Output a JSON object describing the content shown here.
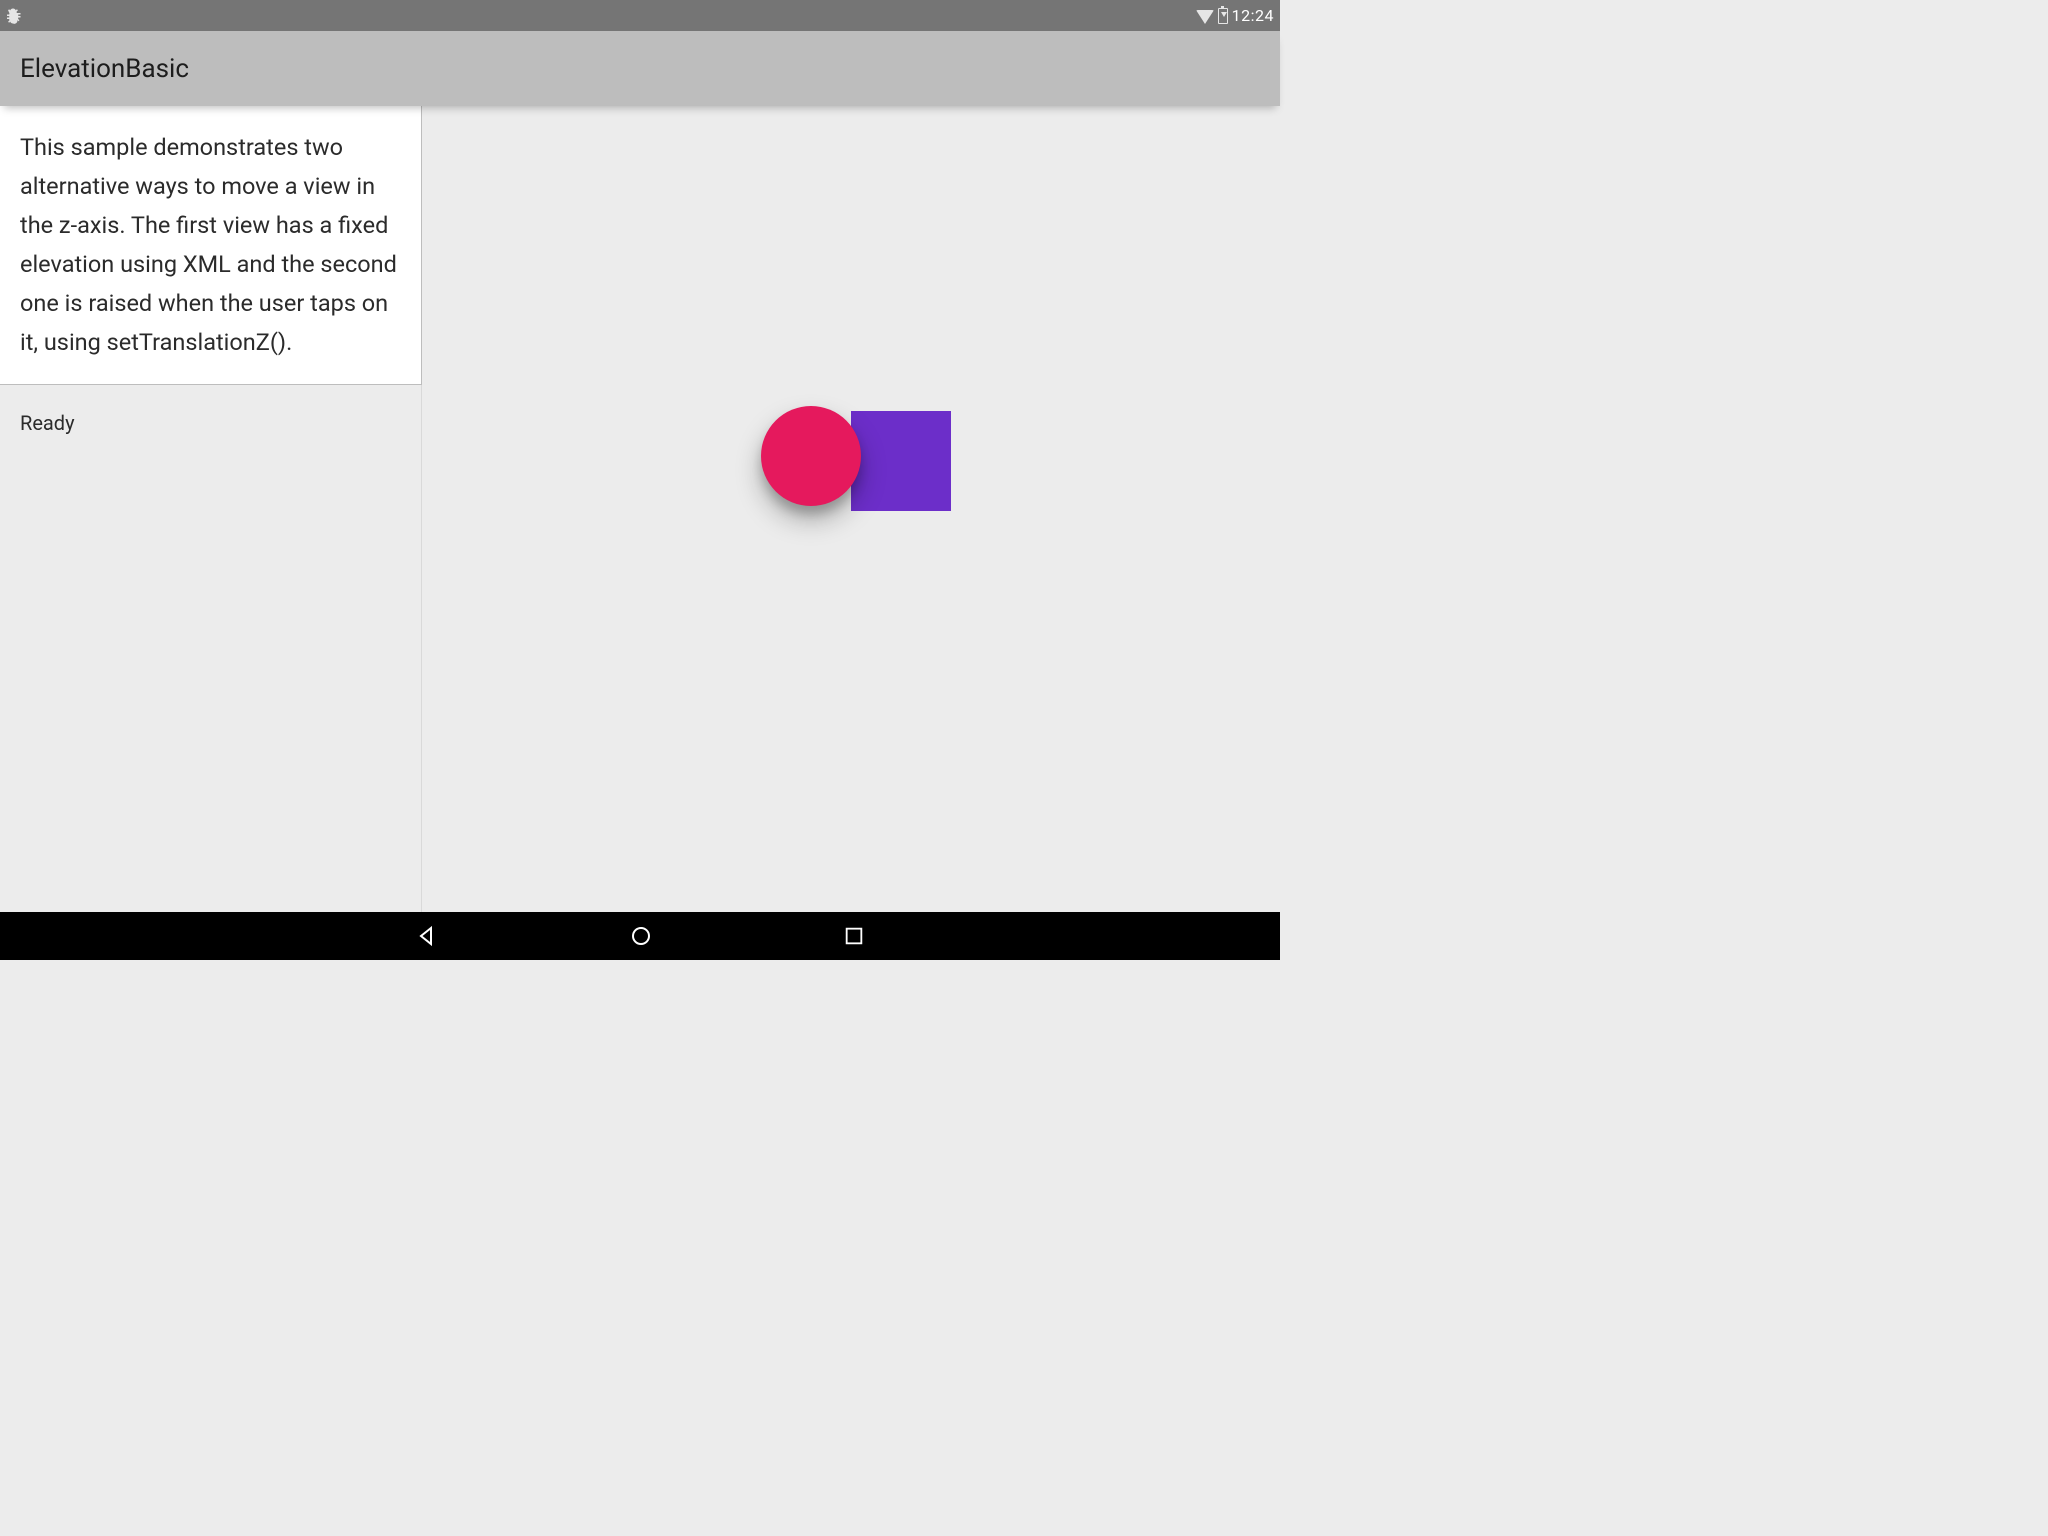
{
  "status_bar": {
    "time": "12:24"
  },
  "app_bar": {
    "title": "ElevationBasic"
  },
  "description": "This sample demonstrates two alternative ways to move a view in the z-axis. The first view has a fixed elevation using XML and the second one is raised when the user taps on it, using setTranslationZ().",
  "log": {
    "status": "Ready"
  },
  "colors": {
    "circle": "#e5195d",
    "square": "#6c2ec9"
  }
}
